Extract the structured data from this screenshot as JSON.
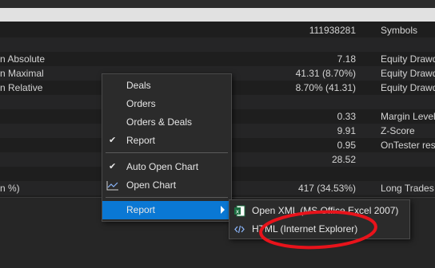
{
  "rows": [
    {
      "label": "",
      "value": "111938281",
      "label2": "Symbols"
    },
    {
      "label": "",
      "value": "",
      "label2": ""
    },
    {
      "label": "n Absolute",
      "value": "7.18",
      "label2": "Equity Drawdo"
    },
    {
      "label": "n Maximal",
      "value": "41.31 (8.70%)",
      "label2": "Equity Drawdo"
    },
    {
      "label": "n Relative",
      "value": "8.70% (41.31)",
      "label2": "Equity Drawdo"
    },
    {
      "label": "",
      "value": "",
      "label2": ""
    },
    {
      "label": "",
      "value": "0.33",
      "label2": "Margin Level"
    },
    {
      "label": "",
      "value": "9.91",
      "label2": "Z-Score"
    },
    {
      "label": "",
      "value": "0.95",
      "label2": "OnTester resu"
    },
    {
      "label": "",
      "value": "28.52",
      "label2": ""
    },
    {
      "label": "",
      "value": "",
      "label2": ""
    },
    {
      "label": "n %)",
      "value": "417 (34.53%)",
      "label2": "Long Trades ("
    }
  ],
  "menu": {
    "items": [
      {
        "label": "Deals",
        "checked": false
      },
      {
        "label": "Orders",
        "checked": false
      },
      {
        "label": "Orders & Deals",
        "checked": false
      },
      {
        "label": "Report",
        "checked": true
      },
      {
        "label": "Auto Open Chart",
        "checked": true
      },
      {
        "label": "Open Chart",
        "icon": "chart-icon"
      },
      {
        "label": "Report",
        "submenu": true,
        "selected": true
      }
    ]
  },
  "submenu": {
    "items": [
      {
        "label": "Open XML (MS Office Excel 2007)",
        "icon": "excel-icon"
      },
      {
        "label": "HTML (Internet Explorer)",
        "icon": "html-code-icon"
      }
    ]
  },
  "annotation": {
    "color": "#e8131b"
  },
  "colors": {
    "selection": "#0a78d4",
    "menu_bg": "#2b2b2b",
    "background": "#1e1e1e"
  }
}
